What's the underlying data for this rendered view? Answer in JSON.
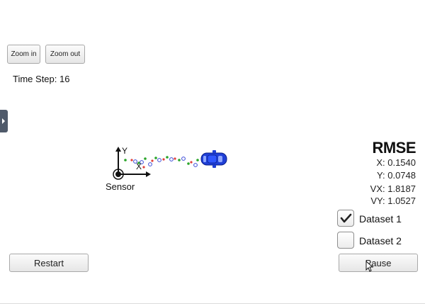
{
  "controls": {
    "zoom_in_label": "Zoom in",
    "zoom_out_label": "Zoom out",
    "restart_label": "Restart",
    "pause_label": "Pause"
  },
  "status": {
    "time_step": "Time Step: 16"
  },
  "scene": {
    "sensor_label": "Sensor",
    "axis_y_label": "Y",
    "axis_x_label": "X",
    "car_icon": "car-icon",
    "colors": {
      "car": "#1f3fd6",
      "lidar": "#e0403a",
      "radar": "#2aa52a",
      "estimate": "#3a4ad8"
    }
  },
  "rmse": {
    "title": "RMSE",
    "x": "X: 0.1540",
    "y": "Y: 0.0748",
    "vx": "VX: 1.8187",
    "vy": "VY: 1.0527"
  },
  "datasets": [
    {
      "label": "Dataset 1",
      "checked": true
    },
    {
      "label": "Dataset 2",
      "checked": false
    }
  ]
}
